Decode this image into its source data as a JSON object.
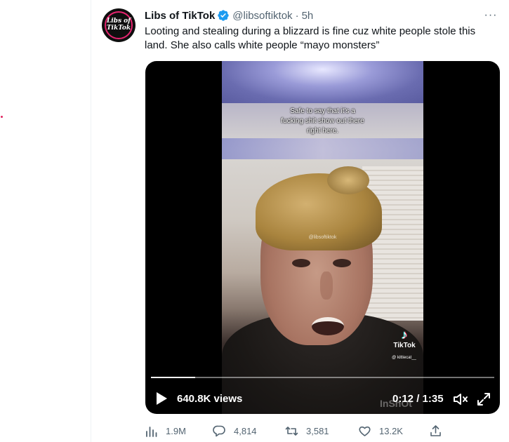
{
  "tweet": {
    "author_name": "Libs of TikTok",
    "handle": "@libsoftiktok",
    "separator": "·",
    "time": "5h",
    "more": "···",
    "text": "Looting and stealing during a blizzard is fine cuz white people stole this land. She also calls white people “mayo monsters”",
    "avatar_text_1": "Libs of",
    "avatar_text_2": "TikTok"
  },
  "video": {
    "overlay_caption_1": "Safe to say that it's a",
    "overlay_caption_2": "fucking shit show out there",
    "overlay_caption_3": "right here.",
    "center_watermark": "@libsoftiktok",
    "tiktok_label": "TikTok",
    "tiktok_user": "@ kittiecat__",
    "inshot_watermark": "InShOt",
    "views": "640.8K views",
    "duration": "0:12 / 1:35",
    "progress_fraction": 0.128
  },
  "actions": {
    "views": "1.9M",
    "replies": "4,814",
    "retweets": "3,581",
    "likes": "13.2K"
  },
  "colors": {
    "verified": "#1d9bf0",
    "text_primary": "#0f1419",
    "text_secondary": "#536471"
  }
}
